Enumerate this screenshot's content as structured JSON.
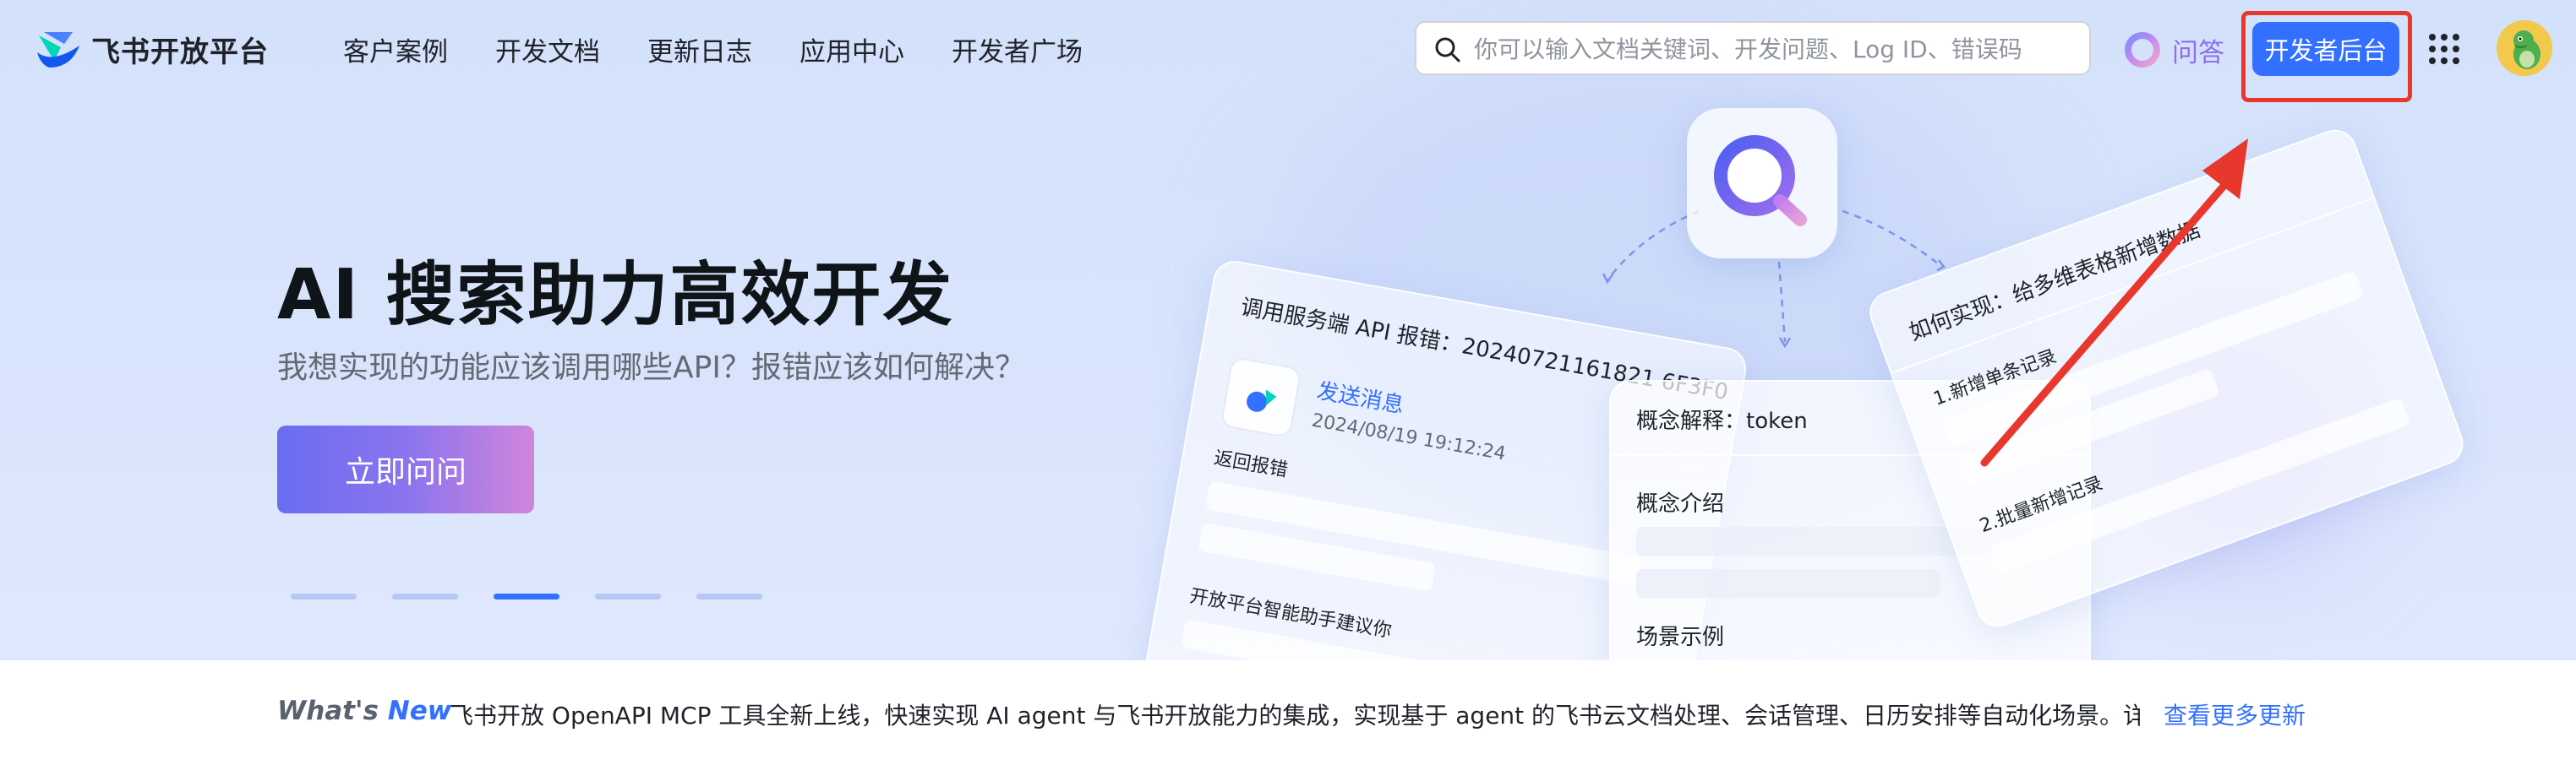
{
  "header": {
    "brand": "飞书开放平台",
    "nav": [
      "客户案例",
      "开发文档",
      "更新日志",
      "应用中心",
      "开发者广场"
    ],
    "search_placeholder": "你可以输入文档关键词、开发问题、Log ID、错误码",
    "ask_label": "问答",
    "console_button": "开发者后台"
  },
  "hero": {
    "title": "AI 搜索助力高效开发",
    "subtitle": "我想实现的功能应该调用哪些API？报错应该如何解决？",
    "cta": "立即问问",
    "carousel_count": 5,
    "carousel_active_index": 2
  },
  "illustration": {
    "left_card": {
      "title": "调用服务端 API 报错：20240721161821 6F3F0",
      "item_title": "发送消息",
      "item_time": "2024/08/19 19:12:24",
      "item_label": "返回报错",
      "footer": "开放平台智能助手建议你"
    },
    "mid_card": {
      "title": "概念解释：token",
      "section1": "概念介绍",
      "section2": "场景示例"
    },
    "right_card": {
      "title": "如何实现：给多维表格新增数据",
      "step1": "1.新增单条记录",
      "step2": "2.批量新增记录"
    }
  },
  "news": {
    "whats": "What's",
    "new": "New",
    "text": "飞书开放 OpenAPI MCP 工具全新上线，快速实现 AI agent 与飞书开放能力的集成，实现基于 agent 的飞书云文档处理、会话管理、日历安排等自动化场景。详...",
    "link": "查看更多更新"
  },
  "colors": {
    "primary": "#3370ff",
    "highlight": "#e8372d",
    "ask_purple": "#8d6ef0"
  }
}
